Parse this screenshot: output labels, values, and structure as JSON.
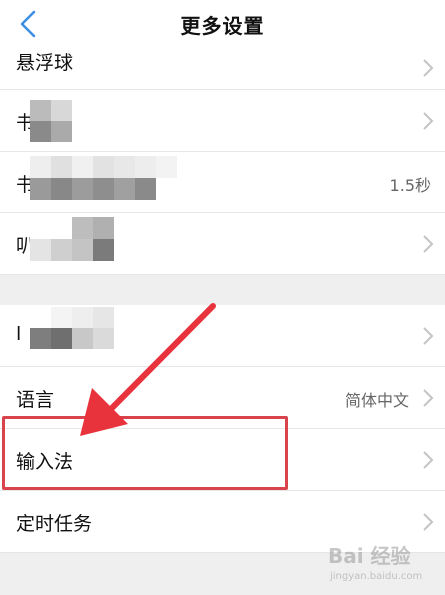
{
  "header": {
    "title": "更多设置"
  },
  "rows": {
    "floating_ball": "悬浮球",
    "row2_fragment": "书",
    "row3_fragment": "书",
    "row3_value": "1.5秒",
    "row4_fragment": "叭",
    "row5_fragment": "l",
    "language": "语言",
    "language_value": "简体中文",
    "input_method": "输入法",
    "scheduled_task": "定时任务"
  },
  "watermark": {
    "brand": "Bai 经验",
    "url": "jingyan.baidu.com"
  },
  "colors": {
    "highlight": "#d9434c",
    "accent": "#3a8ee6"
  }
}
